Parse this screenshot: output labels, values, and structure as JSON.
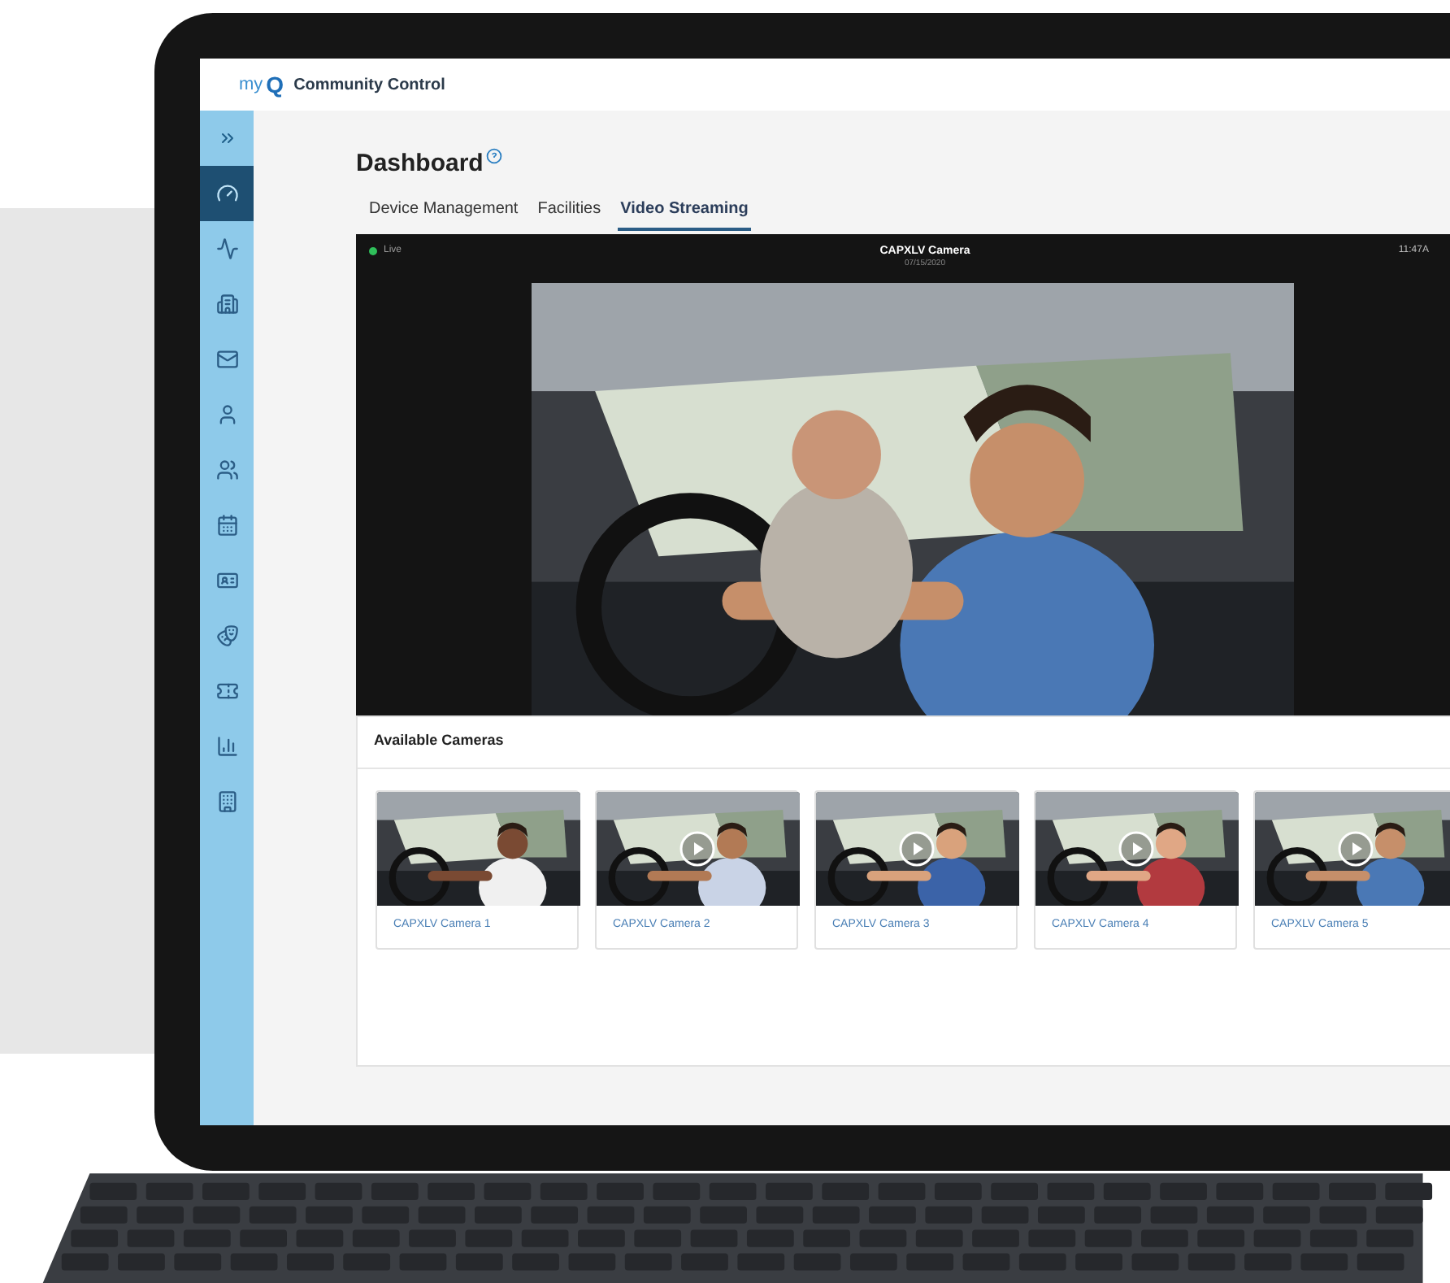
{
  "header": {
    "logo_prefix": "my",
    "logo_letter": "Q",
    "app_name": "Community Control"
  },
  "sidebar": {
    "items": [
      {
        "selected": true
      },
      {
        "selected": false
      },
      {
        "selected": false
      },
      {
        "selected": false
      },
      {
        "selected": false
      },
      {
        "selected": false
      },
      {
        "selected": false
      },
      {
        "selected": false
      },
      {
        "selected": false
      },
      {
        "selected": false
      },
      {
        "selected": false
      },
      {
        "selected": false
      }
    ]
  },
  "page": {
    "title": "Dashboard"
  },
  "tabs": [
    {
      "label": "Device Management",
      "selected": false
    },
    {
      "label": "Facilities",
      "selected": false
    },
    {
      "label": "Video Streaming",
      "selected": true
    }
  ],
  "player": {
    "status": "Live",
    "live": true,
    "camera_name": "CAPXLV Camera",
    "date": "07/15/2020",
    "time": "11:47A"
  },
  "cameras_panel": {
    "title": "Available Cameras",
    "cameras": [
      {
        "name": "CAPXLV Camera 1",
        "play_button": false
      },
      {
        "name": "CAPXLV Camera 2",
        "play_button": true
      },
      {
        "name": "CAPXLV Camera 3",
        "play_button": true
      },
      {
        "name": "CAPXLV Camera 4",
        "play_button": true
      },
      {
        "name": "CAPXLV Camera 5",
        "play_button": true
      }
    ]
  }
}
